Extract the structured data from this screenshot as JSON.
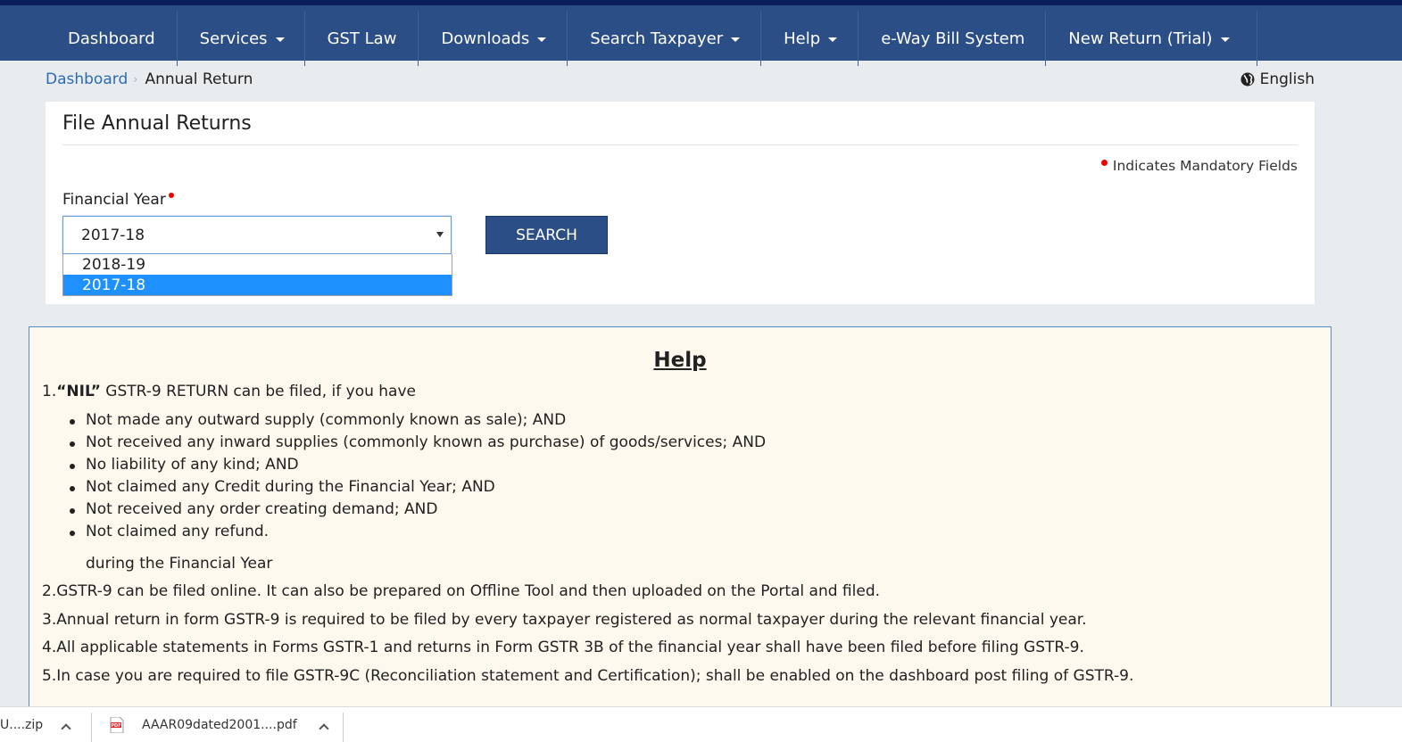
{
  "nav": {
    "items": [
      {
        "label": "Dashboard",
        "dropdown": false
      },
      {
        "label": "Services",
        "dropdown": true
      },
      {
        "label": "GST Law",
        "dropdown": false
      },
      {
        "label": "Downloads",
        "dropdown": true
      },
      {
        "label": "Search Taxpayer",
        "dropdown": true
      },
      {
        "label": "Help",
        "dropdown": true
      },
      {
        "label": "e-Way Bill System",
        "dropdown": false
      },
      {
        "label": "New Return (Trial)",
        "dropdown": true
      }
    ]
  },
  "breadcrumb": {
    "link": "Dashboard",
    "current": "Annual Return"
  },
  "language": "English",
  "panel": {
    "title": "File Annual Returns",
    "mandatory_note": "Indicates Mandatory Fields",
    "fy_label": "Financial Year",
    "fy_selected": "2017-18",
    "fy_options": [
      "2018-19",
      "2017-18"
    ],
    "search_label": "SEARCH"
  },
  "help": {
    "title": "Help",
    "item1_prefix": "1.",
    "item1_bold": "“NIL”",
    "item1_rest": " GSTR-9 RETURN can be filed, if you have",
    "bullets": [
      "Not made any outward supply (commonly known as sale); AND",
      "Not received any inward supplies (commonly known as purchase) of goods/services; AND",
      "No liability of any kind; AND",
      "Not claimed any Credit during the Financial Year; AND",
      "Not received any order creating demand; AND",
      "Not claimed any refund."
    ],
    "during": "during the Financial Year",
    "items": [
      "2.GSTR-9 can be filed online. It can also be prepared on Offline Tool and then uploaded on the Portal and filed.",
      "3.Annual return in form GSTR-9 is required to be filed by every taxpayer registered as normal taxpayer during the relevant financial year.",
      "4.All applicable statements in Forms GSTR-1 and returns in Form GSTR 3B of the financial year shall have been filed before filing GSTR-9.",
      "5.In case you are required to file GSTR-9C (Reconciliation statement and Certification); shall be enabled on the dashboard post filing of GSTR-9."
    ]
  },
  "downloads": [
    {
      "name": "U....zip",
      "icon": "zip-icon"
    },
    {
      "name": "AAAR09dated2001....pdf",
      "icon": "pdf-icon"
    }
  ],
  "colors": {
    "nav_bg": "#2c4e86",
    "nav_top": "#0b1e59",
    "link": "#2c6bb3",
    "selected_option": "#1e90ff",
    "help_bg": "#fdf9ee",
    "mandatory_dot": "#e00000"
  }
}
